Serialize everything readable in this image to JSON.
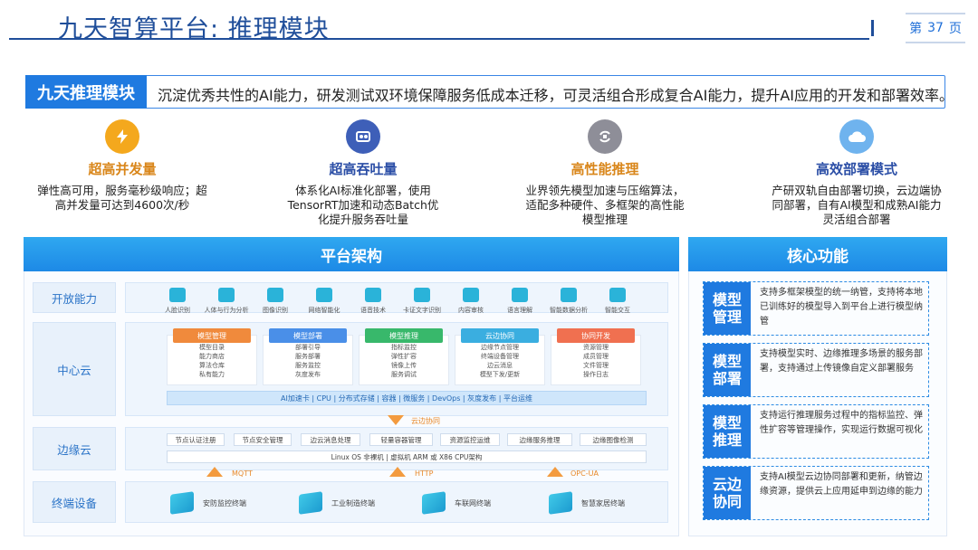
{
  "header": {
    "title": "九天智算平台: 推理模块",
    "page_prefix": "第",
    "page_number": "37",
    "page_suffix": "页"
  },
  "intro": {
    "tag": "九天推理模块",
    "text": "沉淀优秀共性的AI能力，研发测试双环境保障服务低成本迁移，可灵活组合形成复合AI能力，提升AI应用的开发和部署效率。"
  },
  "features": [
    {
      "title": "超高并发量",
      "desc": "弹性高可用，服务毫秒级响应；超高并发量可达到4600次/秒",
      "color": "#f4a81d",
      "title_color": "#d9861a",
      "icon": "bolt-icon"
    },
    {
      "title": "超高吞吐量",
      "desc": "体系化AI标准化部署，使用TensorRT加速和动态Batch优化提升服务吞吐量",
      "color": "#3e5fb8",
      "title_color": "#2b4ea6",
      "icon": "pipeline-icon"
    },
    {
      "title": "高性能推理",
      "desc": "业界领先模型加速与压缩算法，适配多种硬件、多框架的高性能模型推理",
      "color": "#8e8e98",
      "title_color": "#d9861a",
      "icon": "cycle-icon"
    },
    {
      "title": "高效部署模式",
      "desc": "产研双轨自由部署切换，云边端协同部署，自有AI模型和成熟AI能力灵活组合部署",
      "color": "#6fb3ee",
      "title_color": "#2b4ea6",
      "icon": "cloud-icon"
    }
  ],
  "architecture": {
    "title": "平台架构",
    "layers": [
      "开放能力",
      "中心云",
      "边缘云",
      "终端设备"
    ],
    "open_items": [
      "人脸识别",
      "人体与行为分析",
      "图像识别",
      "网络智能化",
      "语音技术",
      "卡证文字识别",
      "内容审核",
      "语言理解",
      "智能数据分析",
      "智能交互"
    ],
    "center_cards": [
      {
        "title": "模型管理",
        "color": "#f08a3c",
        "items": [
          "模型目录",
          "能力商店",
          "算法仓库",
          "私有能力"
        ]
      },
      {
        "title": "模型部署",
        "color": "#4a8fe8",
        "items": [
          "部署引导",
          "服务部署",
          "服务监控",
          "灰度发布"
        ]
      },
      {
        "title": "模型推理",
        "color": "#38b86b",
        "items": [
          "指标监控",
          "弹性扩容",
          "镜像上传",
          "服务调试"
        ]
      },
      {
        "title": "云边协同",
        "color": "#3aaee0",
        "items": [
          "边缘节点管理",
          "终端设备管理",
          "边云消息",
          "模型下发/更新"
        ]
      },
      {
        "title": "协同开发",
        "color": "#f07050",
        "items": [
          "资源管理",
          "成员管理",
          "文件管理",
          "操作日志"
        ]
      }
    ],
    "tech_bar": "AI加速卡 | CPU | 分布式存储 | 容器 | 微服务 | DevOps | 灰度发布 | 平台运维",
    "sync_label": "云边协同",
    "edge_items": [
      "节点认证注册",
      "节点安全管理",
      "边云消息处理",
      "轻量容器管理",
      "资源监控运维",
      "边缘服务推理",
      "边缘图像检测"
    ],
    "edge_os": "Linux OS 非裸机 | 虚拟机 ARM 或 X86 CPU架构",
    "protocols": [
      "MQTT",
      "HTTP",
      "OPC-UA"
    ],
    "terminals": [
      "安防监控终端",
      "工业制造终端",
      "车联网终端",
      "智慧家居终端"
    ]
  },
  "core": {
    "title": "核心功能",
    "rows": [
      {
        "tag": "模型管理",
        "desc": "支持多框架模型的统一纳管，支持将本地已训练好的模型导入到平台上进行模型纳管"
      },
      {
        "tag": "模型部署",
        "desc": "支持模型实时、边缘推理多场景的服务部署，支持通过上传镜像自定义部署服务"
      },
      {
        "tag": "模型推理",
        "desc": "支持运行推理服务过程中的指标监控、弹性扩容等管理操作，实现运行数据可视化"
      },
      {
        "tag": "云边协同",
        "desc": "支持AI模型云边协同部署和更新，纳管边缘资源，提供云上应用延申到边缘的能力"
      }
    ]
  }
}
